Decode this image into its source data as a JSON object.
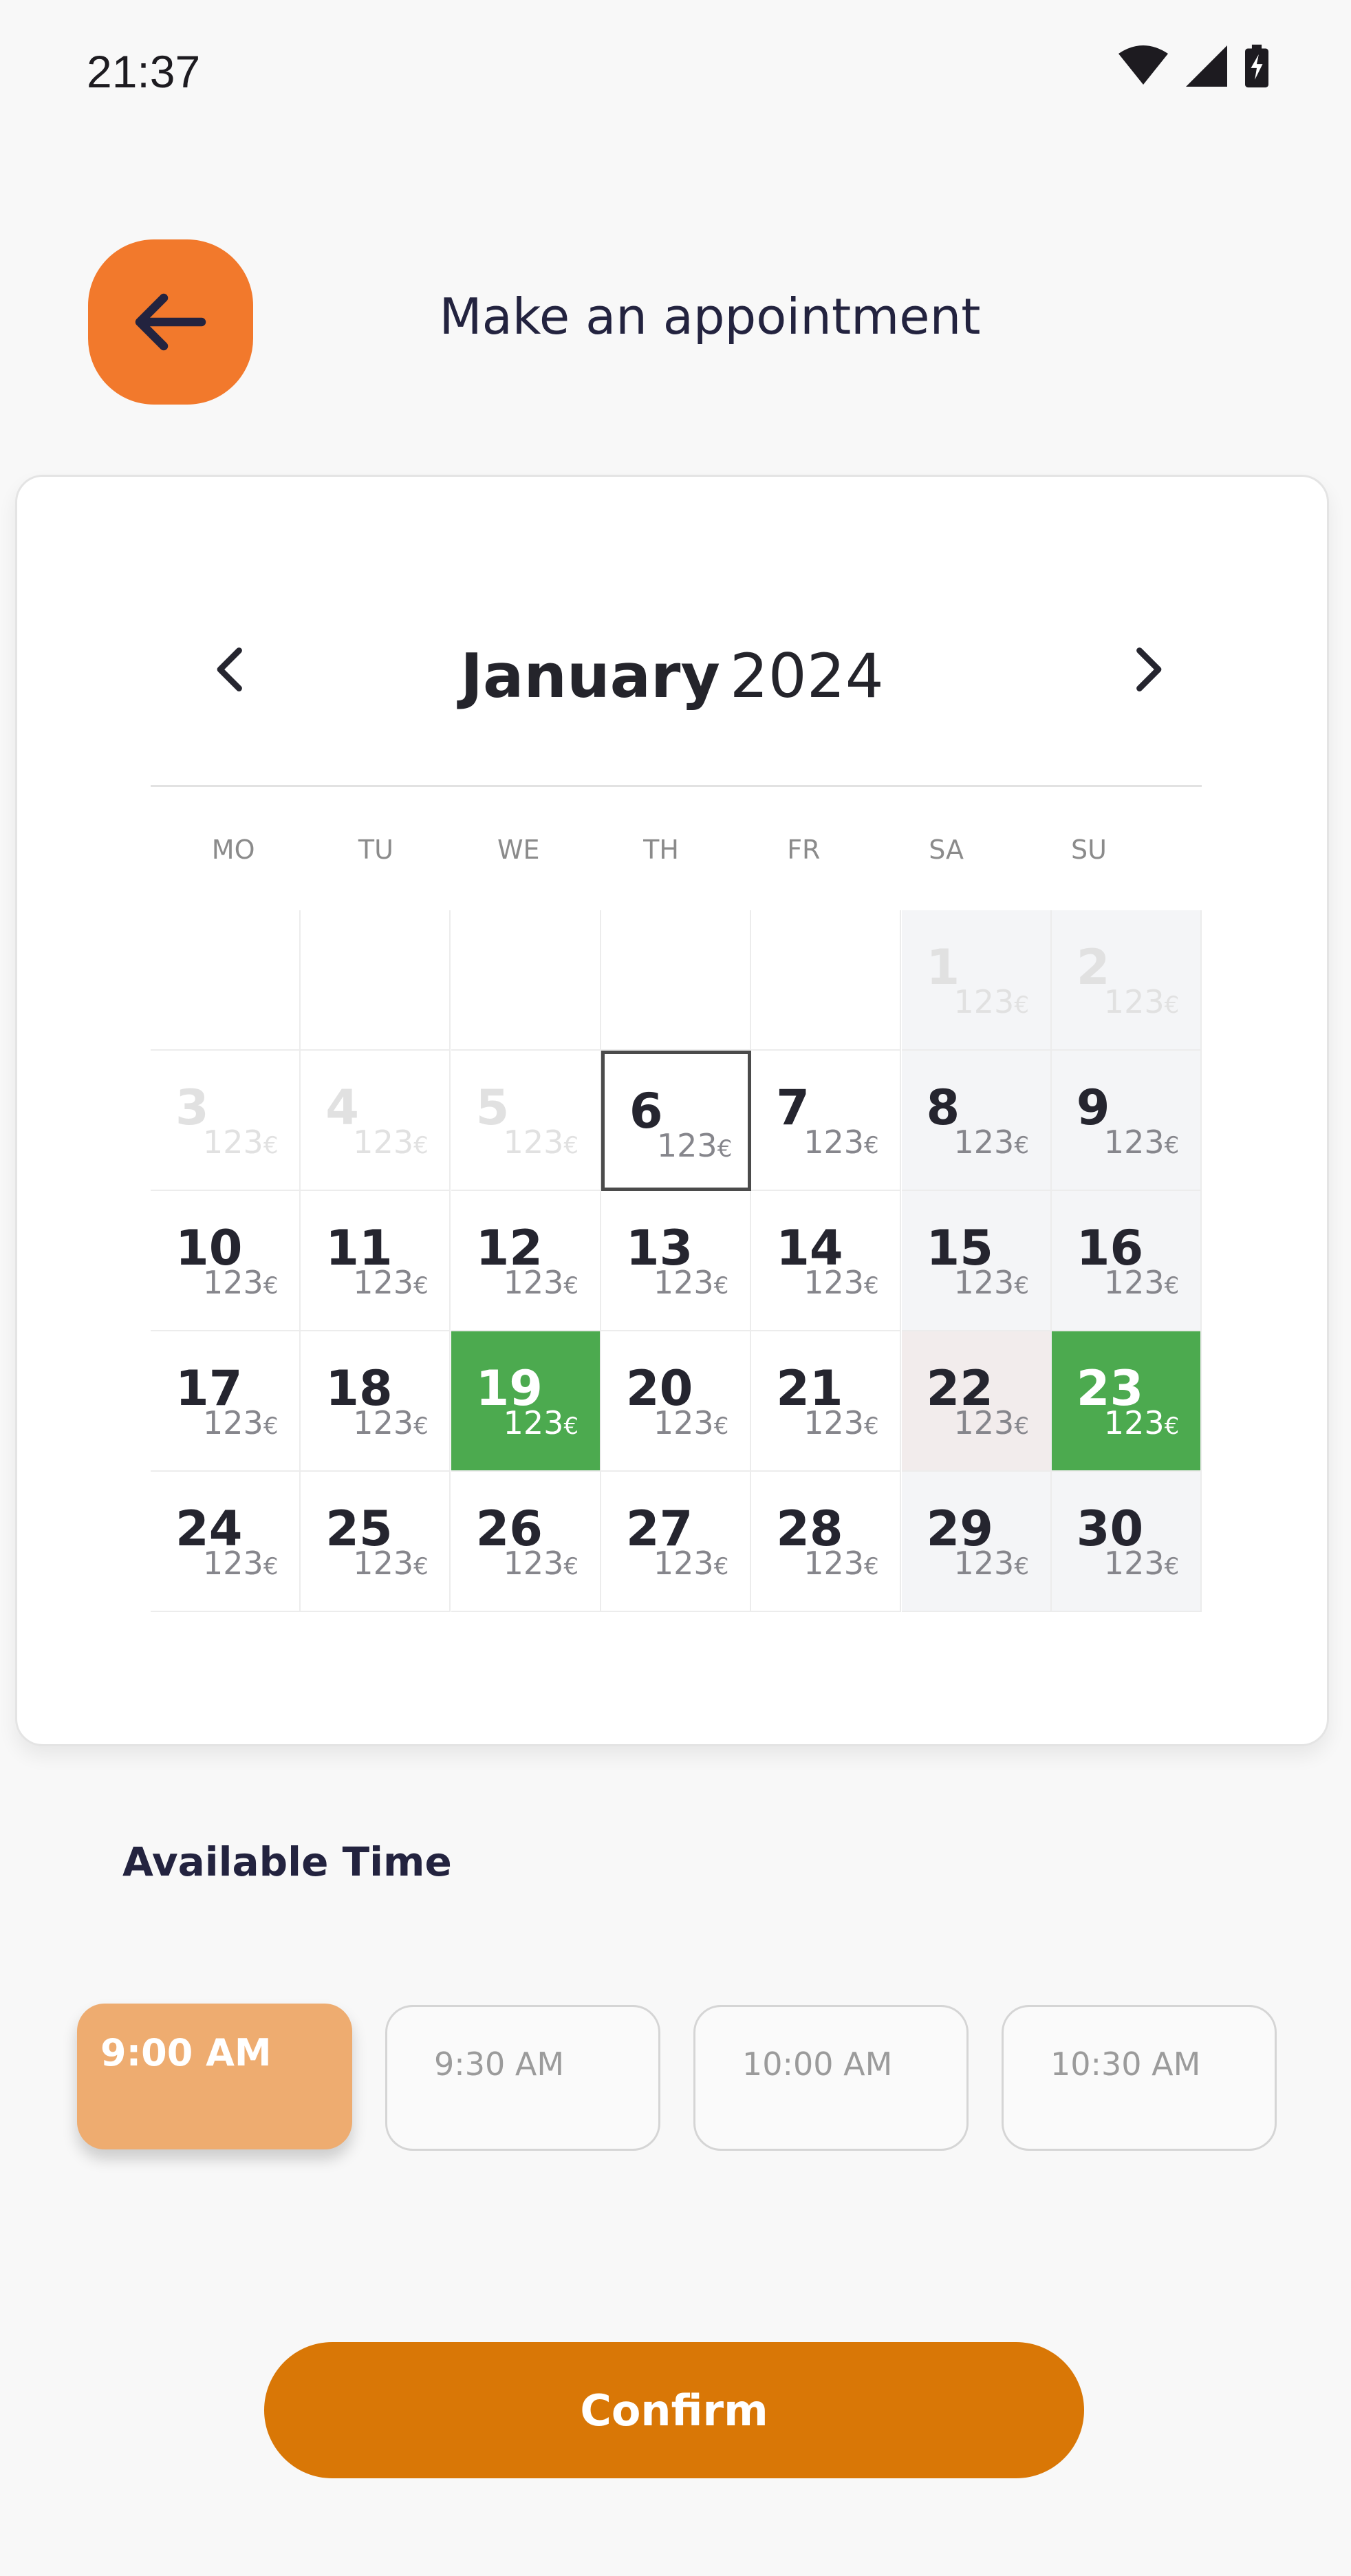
{
  "status_bar": {
    "time": "21:37"
  },
  "header": {
    "title": "Make an appointment"
  },
  "calendar": {
    "month": "January",
    "year": "2024",
    "weekdays": [
      "MO",
      "TU",
      "WE",
      "TH",
      "FR",
      "SA",
      "SU"
    ],
    "price_label": "123",
    "currency": "€",
    "days": [
      {
        "day": "1",
        "state": "disabled",
        "weekend": true
      },
      {
        "day": "2",
        "state": "disabled",
        "weekend": true
      },
      {
        "day": "3",
        "state": "disabled"
      },
      {
        "day": "4",
        "state": "disabled"
      },
      {
        "day": "5",
        "state": "disabled"
      },
      {
        "day": "6",
        "state": "today"
      },
      {
        "day": "7",
        "state": "normal"
      },
      {
        "day": "8",
        "state": "normal",
        "weekend": true
      },
      {
        "day": "9",
        "state": "normal",
        "weekend": true
      },
      {
        "day": "10",
        "state": "normal"
      },
      {
        "day": "11",
        "state": "normal"
      },
      {
        "day": "12",
        "state": "normal"
      },
      {
        "day": "13",
        "state": "normal"
      },
      {
        "day": "14",
        "state": "normal"
      },
      {
        "day": "15",
        "state": "normal",
        "weekend": true
      },
      {
        "day": "16",
        "state": "normal",
        "weekend": true
      },
      {
        "day": "17",
        "state": "normal"
      },
      {
        "day": "18",
        "state": "normal"
      },
      {
        "day": "19",
        "state": "selected"
      },
      {
        "day": "20",
        "state": "normal"
      },
      {
        "day": "21",
        "state": "normal"
      },
      {
        "day": "22",
        "state": "highlight",
        "weekend": true
      },
      {
        "day": "23",
        "state": "selected",
        "weekend": true
      },
      {
        "day": "24",
        "state": "normal"
      },
      {
        "day": "25",
        "state": "normal"
      },
      {
        "day": "26",
        "state": "normal"
      },
      {
        "day": "27",
        "state": "normal"
      },
      {
        "day": "28",
        "state": "normal"
      },
      {
        "day": "29",
        "state": "normal",
        "weekend": true
      },
      {
        "day": "30",
        "state": "normal",
        "weekend": true
      }
    ],
    "colors": {
      "selected": "#4caa4f",
      "weekend": "#f4f5f7",
      "highlight": "#f2ecec"
    }
  },
  "time_section": {
    "label": "Available Time",
    "slots": [
      {
        "label": "9:00 AM",
        "active": true
      },
      {
        "label": "9:30 AM",
        "active": false
      },
      {
        "label": "10:00 AM",
        "active": false
      },
      {
        "label": "10:30 AM",
        "active": false
      }
    ]
  },
  "confirm_button": {
    "label": "Confirm",
    "color": "#d97706"
  },
  "accent_color": "#f2792c"
}
